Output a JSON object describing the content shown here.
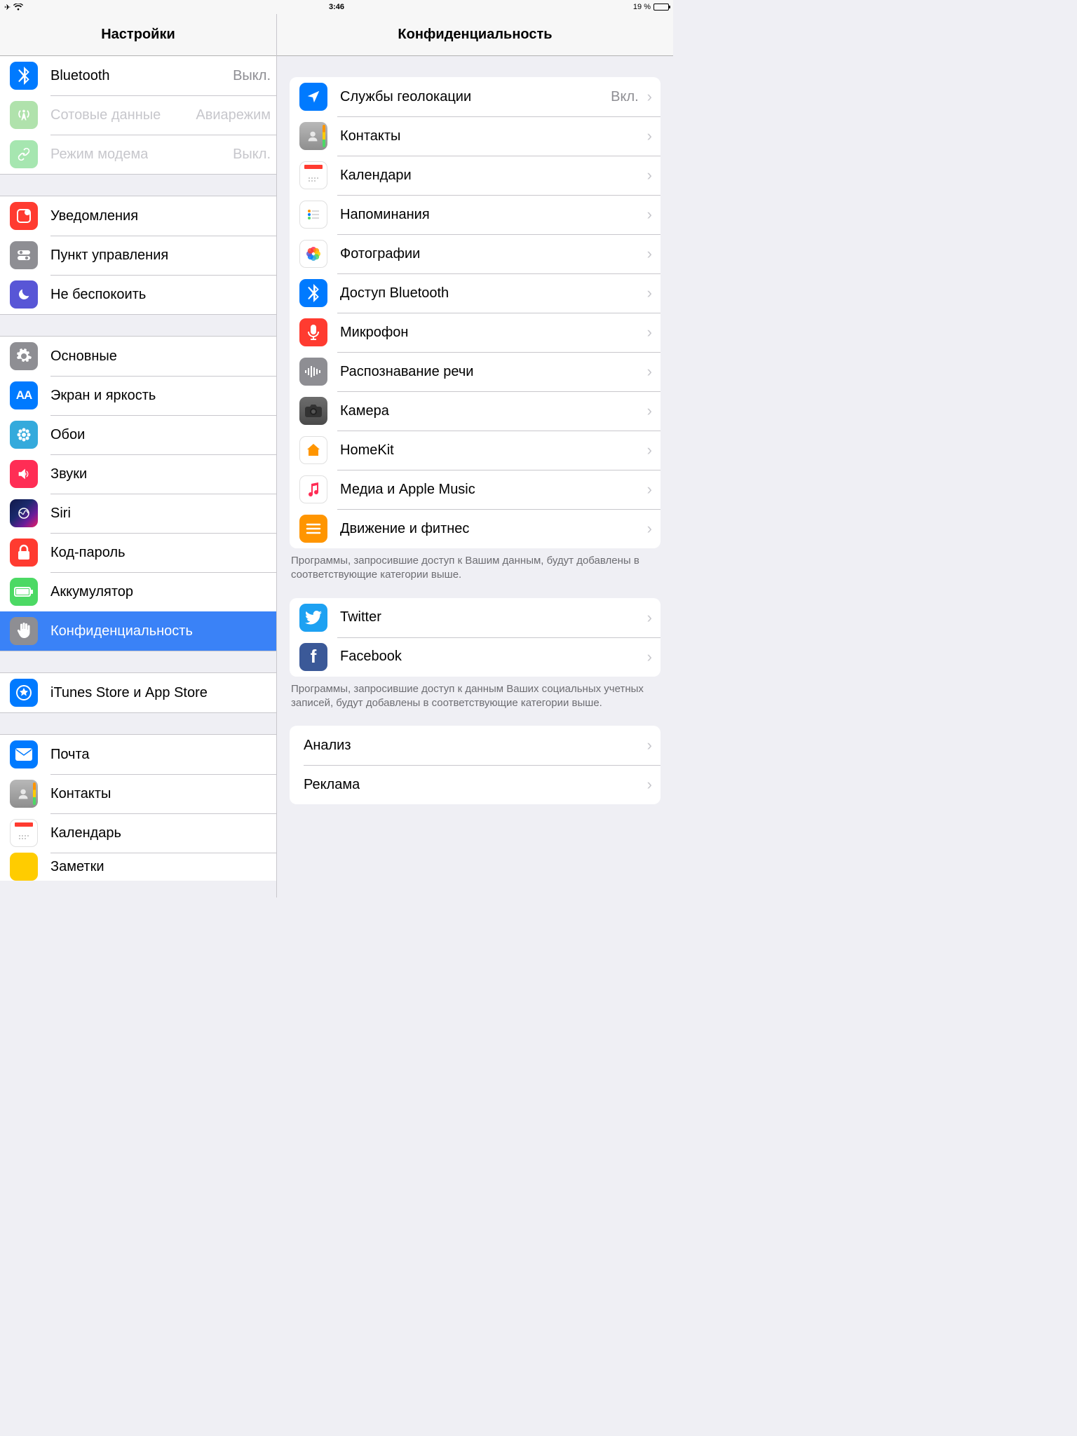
{
  "status": {
    "time": "3:46",
    "battery_text": "19 %"
  },
  "sidebar": {
    "title": "Настройки",
    "groups": [
      {
        "items": [
          {
            "key": "bluetooth",
            "label": "Bluetooth",
            "value": "Выкл.",
            "icon": "bluetooth-icon",
            "bg": "bg-blue"
          },
          {
            "key": "cellular",
            "label": "Сотовые данные",
            "value": "Авиарежим",
            "icon": "antenna-icon",
            "bg": "bg-cellgrn",
            "disabled": true
          },
          {
            "key": "hotspot",
            "label": "Режим модема",
            "value": "Выкл.",
            "icon": "link-icon",
            "bg": "bg-greenlt",
            "disabled": true
          }
        ]
      },
      {
        "items": [
          {
            "key": "notifications",
            "label": "Уведомления",
            "icon": "notification-icon",
            "bg": "bg-red"
          },
          {
            "key": "control-center",
            "label": "Пункт управления",
            "icon": "switches-icon",
            "bg": "bg-gray"
          },
          {
            "key": "dnd",
            "label": "Не беспокоить",
            "icon": "moon-icon",
            "bg": "bg-indigo"
          }
        ]
      },
      {
        "items": [
          {
            "key": "general",
            "label": "Основные",
            "icon": "gear-icon",
            "bg": "bg-gray"
          },
          {
            "key": "display",
            "label": "Экран и яркость",
            "icon": "aa-icon",
            "bg": "bg-blue"
          },
          {
            "key": "wallpaper",
            "label": "Обои",
            "icon": "flower-icon",
            "bg": "bg-teal"
          },
          {
            "key": "sounds",
            "label": "Звуки",
            "icon": "speaker-icon",
            "bg": "bg-pink"
          },
          {
            "key": "siri",
            "label": "Siri",
            "icon": "siri-icon",
            "bg": "bg-siri"
          },
          {
            "key": "passcode",
            "label": "Код-пароль",
            "icon": "lock-icon",
            "bg": "bg-red"
          },
          {
            "key": "battery",
            "label": "Аккумулятор",
            "icon": "battery-icon",
            "bg": "bg-green"
          },
          {
            "key": "privacy",
            "label": "Конфиденциальность",
            "icon": "hand-icon",
            "bg": "bg-gray",
            "selected": true
          }
        ]
      },
      {
        "items": [
          {
            "key": "itunes",
            "label": "iTunes Store и App Store",
            "icon": "appstore-icon",
            "bg": "bg-blue"
          }
        ]
      },
      {
        "items": [
          {
            "key": "mail",
            "label": "Почта",
            "icon": "mail-icon",
            "bg": "bg-blue"
          },
          {
            "key": "contacts",
            "label": "Контакты",
            "icon": "contacts-icon",
            "bg": "bg-contacts"
          },
          {
            "key": "calendar",
            "label": "Календарь",
            "icon": "calendar-icon",
            "bg": "bg-cal"
          },
          {
            "key": "notes",
            "label": "Заметки",
            "icon": "notes-icon",
            "bg": "bg-yellow"
          }
        ]
      }
    ]
  },
  "detail": {
    "title": "Конфиденциальность",
    "groups": [
      {
        "items": [
          {
            "key": "location",
            "label": "Службы геолокации",
            "value": "Вкл.",
            "icon": "location-icon",
            "bg": "bg-blue"
          },
          {
            "key": "contacts",
            "label": "Контакты",
            "icon": "contacts-icon",
            "bg": "bg-contacts"
          },
          {
            "key": "calendars",
            "label": "Календари",
            "icon": "calendar-icon",
            "bg": "bg-cal"
          },
          {
            "key": "reminders",
            "label": "Напоминания",
            "icon": "reminders-icon",
            "bg": "bg-white"
          },
          {
            "key": "photos",
            "label": "Фотографии",
            "icon": "photos-icon",
            "bg": "bg-photos"
          },
          {
            "key": "bluetooth",
            "label": "Доступ Bluetooth",
            "icon": "bluetooth-icon",
            "bg": "bg-blue"
          },
          {
            "key": "microphone",
            "label": "Микрофон",
            "icon": "mic-icon",
            "bg": "bg-red"
          },
          {
            "key": "speech",
            "label": "Распознавание речи",
            "icon": "waveform-icon",
            "bg": "bg-gray"
          },
          {
            "key": "camera",
            "label": "Камера",
            "icon": "camera-icon",
            "bg": "bg-camera"
          },
          {
            "key": "homekit",
            "label": "HomeKit",
            "icon": "home-icon",
            "bg": "bg-white"
          },
          {
            "key": "media",
            "label": "Медиа и Apple Music",
            "icon": "music-icon",
            "bg": "bg-white"
          },
          {
            "key": "motion",
            "label": "Движение и фитнес",
            "icon": "motion-icon",
            "bg": "bg-orange"
          }
        ],
        "footer": "Программы, запросившие доступ к Вашим данным, будут добавлены в соответствующие категории выше."
      },
      {
        "items": [
          {
            "key": "twitter",
            "label": "Twitter",
            "icon": "twitter-icon",
            "bg": "bg-twitter"
          },
          {
            "key": "facebook",
            "label": "Facebook",
            "icon": "facebook-icon",
            "bg": "bg-fb"
          }
        ],
        "footer": "Программы, запросившие доступ к данным Ваших социальных учетных записей, будут добавлены в соответствующие категории выше."
      },
      {
        "items": [
          {
            "key": "analytics",
            "label": "Анализ",
            "no_icon": true
          },
          {
            "key": "ads",
            "label": "Реклама",
            "no_icon": true
          }
        ]
      }
    ]
  }
}
